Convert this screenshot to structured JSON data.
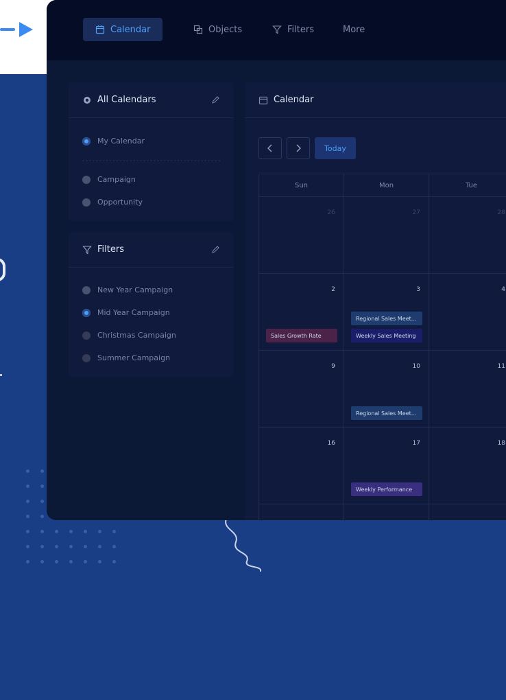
{
  "nav": {
    "items": [
      {
        "label": "Calendar",
        "icon": "calendar-icon",
        "active": true
      },
      {
        "label": "Objects",
        "icon": "objects-icon",
        "active": false
      },
      {
        "label": "Filters",
        "icon": "filter-icon",
        "active": false
      },
      {
        "label": "More",
        "icon": "",
        "active": false
      }
    ]
  },
  "all_calendars": {
    "title": "All Calendars",
    "items": [
      {
        "label": "My Calendar",
        "selected": true
      },
      {
        "label": "Campaign",
        "selected": false
      },
      {
        "label": "Opportunity",
        "selected": false
      }
    ]
  },
  "filters": {
    "title": "Filters",
    "items": [
      {
        "label": "New Year Campaign",
        "selected": false
      },
      {
        "label": "Mid Year Campaign",
        "selected": true
      },
      {
        "label": "Christmas Campaign",
        "selected": false
      },
      {
        "label": "Summer Campaign",
        "selected": false
      }
    ]
  },
  "calendar": {
    "title": "Calendar",
    "today_label": "Today",
    "weekdays": [
      "Sun",
      "Mon",
      "Tue"
    ],
    "weeks": [
      {
        "days": [
          "26",
          "27",
          "28"
        ]
      },
      {
        "days": [
          "2",
          "3",
          "4"
        ]
      },
      {
        "days": [
          "9",
          "10",
          "11"
        ]
      },
      {
        "days": [
          "16",
          "17",
          "18"
        ]
      }
    ],
    "events": {
      "sun_2": "Sales Growth Rate",
      "mon_3_a": "Regional Sales Meet...",
      "mon_3_b": "Weekly Sales Meeting",
      "mon_10": "Regional Sales Meet...",
      "mon_17": "Weekly Performance"
    }
  },
  "colors": {
    "background": "#1a3e86",
    "accent": "#4d9ef7",
    "app": "#0b1836"
  }
}
